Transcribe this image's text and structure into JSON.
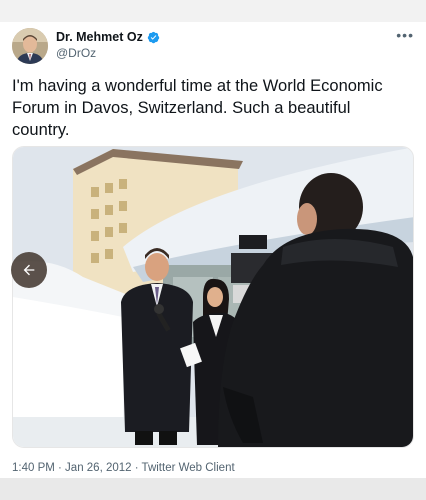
{
  "tweet": {
    "display_name": "Dr. Mehmet Oz",
    "handle": "@DrOz",
    "text": "I'm having a wonderful time at the World Economic Forum in Davos, Switzerland. Such a beautiful country.",
    "timestamp": "1:40 PM · Jan 26, 2012 · Twitter Web Client"
  },
  "icons": {
    "verified": "verified-badge-icon",
    "more": "more-options-icon",
    "prev": "arrow-left-icon"
  },
  "colors": {
    "verified_blue": "#1d9bf0",
    "secondary_text": "#536471",
    "primary_text": "#0f1419"
  }
}
